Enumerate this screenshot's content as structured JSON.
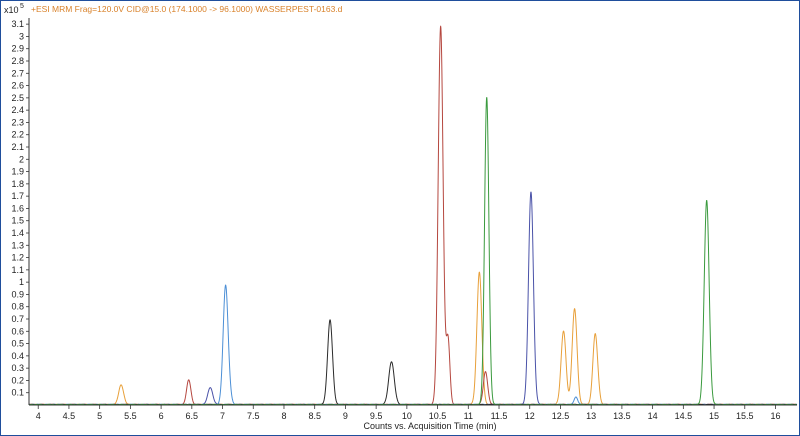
{
  "chart_data": {
    "type": "line",
    "title": "+ESI MRM Frag=120.0V CID@15.0 (174.1000 -> 96.1000) WASSERPEST-0163.d",
    "scale_label": "x10",
    "scale_exponent": "5",
    "xlabel": "Counts vs. Acquisition Time (min)",
    "ylabel": "",
    "xlim": [
      3.85,
      16.35
    ],
    "ylim": [
      0,
      3.15
    ],
    "x_ticks": [
      "4",
      "4.5",
      "5",
      "5.5",
      "6",
      "6.5",
      "7",
      "7.5",
      "8",
      "8.5",
      "9",
      "9.5",
      "10",
      "10.5",
      "11",
      "11.5",
      "12",
      "12.5",
      "13",
      "13.5",
      "14",
      "14.5",
      "15",
      "15.5",
      "16"
    ],
    "y_ticks": [
      "0.1",
      "0.2",
      "0.3",
      "0.4",
      "0.5",
      "0.6",
      "0.7",
      "0.8",
      "0.9",
      "1",
      "1.1",
      "1.2",
      "1.3",
      "1.4",
      "1.5",
      "1.6",
      "1.7",
      "1.8",
      "1.9",
      "2",
      "2.1",
      "2.2",
      "2.3",
      "2.4",
      "2.5",
      "2.6",
      "2.7",
      "2.8",
      "2.9",
      "3",
      "3.1"
    ],
    "series": [
      {
        "color": "#e8a03a",
        "peaks": [
          [
            5.35,
            0.16,
            0.04
          ],
          [
            11.18,
            1.08,
            0.04
          ],
          [
            12.55,
            0.6,
            0.04
          ],
          [
            12.73,
            0.78,
            0.04
          ],
          [
            13.07,
            0.51,
            0.04
          ],
          [
            13.05,
            0.08,
            0.03
          ]
        ]
      },
      {
        "color": "#b5473f",
        "peaks": [
          [
            6.45,
            0.2,
            0.035
          ],
          [
            10.55,
            3.08,
            0.04
          ],
          [
            10.67,
            0.53,
            0.03
          ],
          [
            11.28,
            0.27,
            0.035
          ]
        ]
      },
      {
        "color": "#4a52a8",
        "peaks": [
          [
            6.8,
            0.14,
            0.04
          ],
          [
            12.02,
            1.73,
            0.04
          ]
        ]
      },
      {
        "color": "#4c8fd6",
        "peaks": [
          [
            7.05,
            0.97,
            0.04
          ],
          [
            7.12,
            0.05,
            0.03
          ],
          [
            12.75,
            0.06,
            0.03
          ]
        ]
      },
      {
        "color": "#2a2a2a",
        "peaks": [
          [
            8.75,
            0.69,
            0.04
          ],
          [
            9.75,
            0.35,
            0.045
          ]
        ]
      },
      {
        "color": "#3a9a3e",
        "peaks": [
          [
            11.3,
            2.5,
            0.035
          ],
          [
            14.88,
            1.66,
            0.04
          ]
        ]
      }
    ]
  }
}
